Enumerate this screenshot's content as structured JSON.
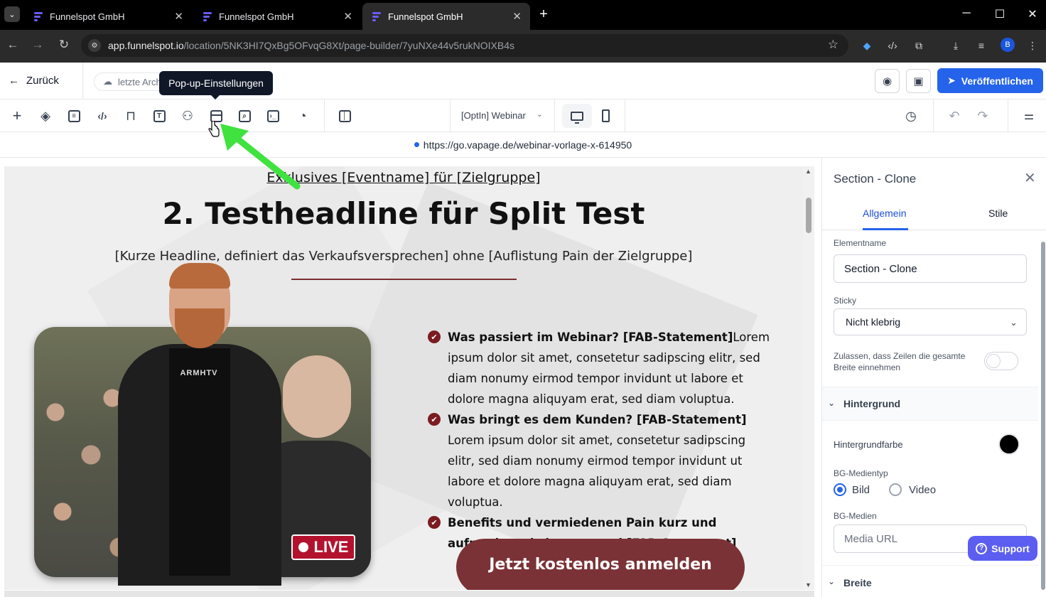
{
  "browser": {
    "tabs": [
      {
        "title": "Funnelspot GmbH",
        "close": "✕"
      },
      {
        "title": "Funnelspot GmbH",
        "close": "✕"
      },
      {
        "title": "Funnelspot GmbH",
        "close": "✕"
      }
    ],
    "new_tab": "+",
    "window": {
      "minimize": "─",
      "maximize": "☐",
      "close": "✕"
    },
    "address": {
      "host": "app.funnelspot.io",
      "path": "/location/5NK3HI7QxBg5OFvqG8Xt/page-builder/7yuNXe44v5rukNOIXB4s"
    },
    "profile_initial": "B",
    "active_tab_index": 2
  },
  "header": {
    "back_label": "Zurück",
    "archive_label": "letzte Arch",
    "tooltip": "Pop-up-Einstellungen",
    "publish_label": "Veröffentlichen"
  },
  "toolbar": {
    "icons": [
      "add-icon",
      "layers-icon",
      "pages-icon",
      "code-icon",
      "paint-roller-icon",
      "text-icon",
      "colors-icon",
      "popup-settings-icon",
      "search-page-icon",
      "terminal-icon",
      "cookie-icon",
      "split-view-icon"
    ],
    "page_select": "[OptIn] Webinar",
    "device": "desktop"
  },
  "preview_url": "https://go.vapage.de/webinar-vorlage-x-614950",
  "canvas": {
    "event_line": "Exklusives [Eventname] für [Zielgruppe]",
    "headline": "2. Testheadline für Split Test",
    "subline": "[Kurze Headline, definiert das Verkaufsversprechen] ohne [Auflistung Pain der Zielgruppe]",
    "shirt_print": "ARMHTV",
    "live_badge": "LIVE",
    "bullets": [
      {
        "bold": "Was passiert im Webinar? [FAB-Statement]",
        "text": "Lorem ipsum dolor sit amet, consetetur sadipscing elitr, sed diam nonumy eirmod tempor invidunt ut labore et dolore magna aliquyam erat, sed diam voluptua."
      },
      {
        "bold": "Was bringt es dem Kunden? [FAB-Statement]",
        "text": " Lorem ipsum dolor sit amet, consetetur sadipscing elitr, sed diam nonumy eirmod tempor invidunt ut labore et dolore magna aliquyam erat, sed diam voluptua."
      },
      {
        "bold": "Benefits und vermiedenen Pain kurz und aufmerksamkeitserregend [FAB-Statement]",
        "text": ""
      }
    ],
    "cta_label": "Jetzt kostenlos anmelden"
  },
  "panel": {
    "title": "Section - Clone",
    "tabs": [
      "Allgemein",
      "Stile"
    ],
    "active_tab": "Allgemein",
    "element_name_label": "Elementname",
    "element_name_value": "Section - Clone",
    "sticky_label": "Sticky",
    "sticky_value": "Nicht klebrig",
    "fullwidth_label": "Zulassen, dass Zeilen die gesamte Breite einnehmen",
    "fullwidth_on": false,
    "background_section": "Hintergrund",
    "bg_color_label": "Hintergrundfarbe",
    "bg_color": "#000000",
    "bg_media_type_label": "BG-Medientyp",
    "bg_media_options": [
      "Bild",
      "Video"
    ],
    "bg_media_selected": "Bild",
    "bg_media_label": "BG-Medien",
    "bg_media_placeholder": "Media URL",
    "width_section": "Breite"
  },
  "support_label": "Support",
  "colors": {
    "accent": "#2563eb",
    "brand_red": "#7b3236",
    "live_red": "#b3122e",
    "check_red": "#7b1c20",
    "arrow_green": "#3fe23f",
    "support_purple": "#5b5ef0"
  }
}
